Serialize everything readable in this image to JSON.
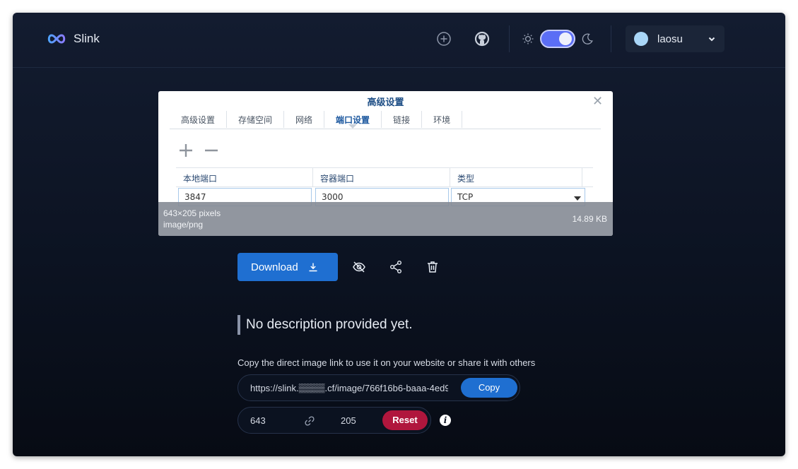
{
  "brand": {
    "name": "Slink",
    "icon": "infinity-logo-icon"
  },
  "header": {
    "upload_icon": "plus-circle-icon",
    "github_icon": "github-icon",
    "theme": {
      "light_icon": "sun-icon",
      "dark_icon": "moon-icon",
      "dark_mode": true
    },
    "user": {
      "name": "laosu",
      "menu_icon": "chevron-down-icon"
    }
  },
  "preview": {
    "dialog_title": "高级设置",
    "tabs": [
      "高级设置",
      "存储空间",
      "网络",
      "端口设置",
      "链接",
      "环境"
    ],
    "active_tab": "端口设置",
    "columns": [
      "本地端口",
      "容器端口",
      "类型"
    ],
    "row": {
      "local_port": "3847",
      "container_port": "3000",
      "type": "TCP"
    },
    "info": {
      "dimensions": "643×205 pixels",
      "mime": "image/png",
      "size": "14.89 KB"
    }
  },
  "actions": {
    "download_label": "Download",
    "visibility_icon": "eye-off-icon",
    "share_icon": "share-icon",
    "delete_icon": "trash-icon"
  },
  "description": "No description provided yet.",
  "link": {
    "hint": "Copy the direct image link to use it on your website or share it with others",
    "url": "https://slink.▒▒▒▒.cf/image/766f16b6-baaa-4ed9-",
    "copy_label": "Copy"
  },
  "resize": {
    "width": "643",
    "height": "205",
    "reset_label": "Reset",
    "info_symbol": "i"
  },
  "colors": {
    "accent": "#1f6fd1",
    "danger": "#b0163d",
    "toggle": "#5b6ef5"
  }
}
